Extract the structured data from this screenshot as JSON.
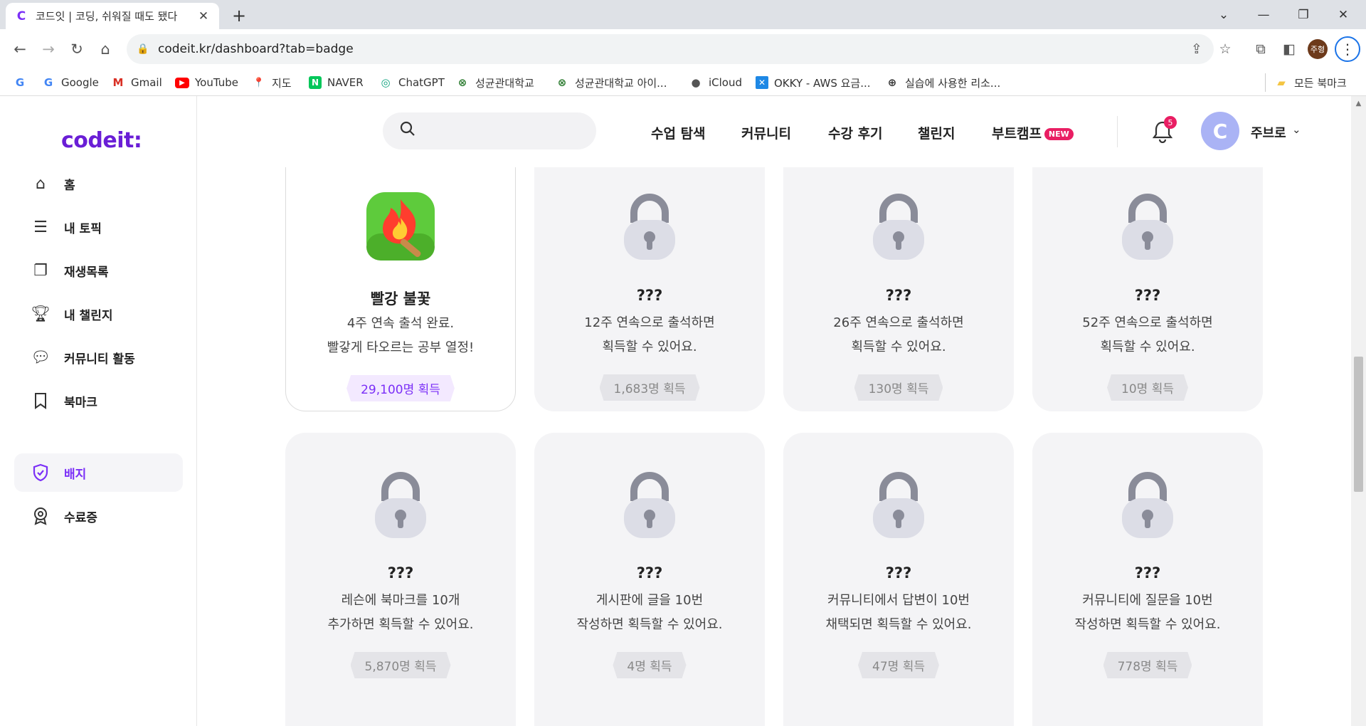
{
  "browser": {
    "tab_title": "코드잇 | 코딩, 쉬워질 때도 됐다",
    "url": "codeit.kr/dashboard?tab=badge",
    "profile_initials": "주형",
    "bookmarks": [
      {
        "label": "",
        "icon": "G"
      },
      {
        "label": "Google",
        "icon": "G"
      },
      {
        "label": "Gmail",
        "icon": "M"
      },
      {
        "label": "YouTube",
        "icon": "▶"
      },
      {
        "label": "지도",
        "icon": "📍"
      },
      {
        "label": "NAVER",
        "icon": "N"
      },
      {
        "label": "ChatGPT",
        "icon": "◎"
      },
      {
        "label": "성균관대학교",
        "icon": "⊗"
      },
      {
        "label": "성균관대학교 아이...",
        "icon": "⊗"
      },
      {
        "label": "iCloud",
        "icon": ""
      },
      {
        "label": "OKKY - AWS 요금...",
        "icon": "✕"
      },
      {
        "label": "실습에 사용한 리소...",
        "icon": "⊕"
      }
    ],
    "all_bookmarks_label": "모든 북마크"
  },
  "sidebar": {
    "logo": "codeit:",
    "items": [
      {
        "label": "홈",
        "icon": "home-icon"
      },
      {
        "label": "내 토픽",
        "icon": "stack-icon"
      },
      {
        "label": "재생목록",
        "icon": "playlist-icon"
      },
      {
        "label": "내 챌린지",
        "icon": "trophy-icon"
      },
      {
        "label": "커뮤니티 활동",
        "icon": "chat-icon"
      },
      {
        "label": "북마크",
        "icon": "bookmark-icon"
      },
      {
        "label": "배지",
        "icon": "shield-check-icon",
        "active": true
      },
      {
        "label": "수료증",
        "icon": "medal-icon"
      }
    ]
  },
  "header": {
    "search_placeholder": "",
    "nav": [
      "수업 탐색",
      "커뮤니티",
      "수강 후기",
      "챌린지",
      "부트캠프"
    ],
    "new_badge": "NEW",
    "notification_count": "5",
    "username": "주브로"
  },
  "badges": [
    {
      "title": "빨강 불꽃",
      "desc1": "4주 연속 출석 완료.",
      "desc2": "빨갛게 타오르는 공부 열정!",
      "count": "29,100명 획득",
      "earned": true
    },
    {
      "title": "???",
      "desc1": "12주 연속으로 출석하면",
      "desc2": "획득할 수 있어요.",
      "count": "1,683명 획득",
      "earned": false
    },
    {
      "title": "???",
      "desc1": "26주 연속으로 출석하면",
      "desc2": "획득할 수 있어요.",
      "count": "130명 획득",
      "earned": false
    },
    {
      "title": "???",
      "desc1": "52주 연속으로 출석하면",
      "desc2": "획득할 수 있어요.",
      "count": "10명 획득",
      "earned": false
    },
    {
      "title": "???",
      "desc1": "레슨에 북마크를 10개",
      "desc2": "추가하면 획득할 수 있어요.",
      "count": "5,870명 획득",
      "earned": false
    },
    {
      "title": "???",
      "desc1": "게시판에 글을 10번",
      "desc2": "작성하면 획득할 수 있어요.",
      "count": "4명 획득",
      "earned": false
    },
    {
      "title": "???",
      "desc1": "커뮤니티에서 답변이 10번",
      "desc2": "채택되면 획득할 수 있어요.",
      "count": "47명 획득",
      "earned": false
    },
    {
      "title": "???",
      "desc1": "커뮤니티에 질문을 10번",
      "desc2": "작성하면 획득할 수 있어요.",
      "count": "778명 획득",
      "earned": false
    }
  ],
  "colors": {
    "accent": "#7b2ff7",
    "new_badge": "#e91e63",
    "card_bg": "#f4f4f6"
  }
}
